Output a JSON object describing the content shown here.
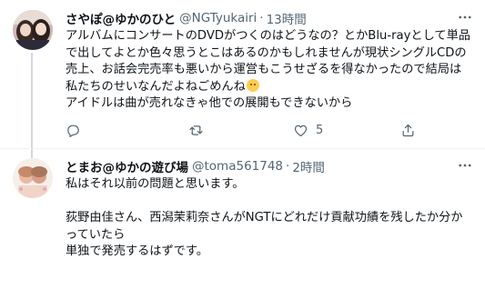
{
  "tweets": [
    {
      "display_name": "さやぽ@ゆかのひと",
      "handle": "@NGTyukairi",
      "separator": "·",
      "time": "13時間",
      "text_lines": [
        "アルバムにコンサートのDVDがつくのはどうなの？とかBlu-rayとして単品",
        "で出してよとか色々思うとこはあるのかもしれませんが現状シングルCDの",
        "売上、お話会完売率も悪いから運営もこうせざるを得なかったので結局は",
        "私たちのせいなんだよねごめんね",
        "アイドルは曲が売れなきゃ他での展開もできないから"
      ],
      "emoji_name": "crying-face-emoji",
      "reply_count": "",
      "retweet_count": "",
      "like_count": "5"
    },
    {
      "display_name": "とまお@ゆかの遊び場",
      "handle": "@toma561748",
      "separator": "·",
      "time": "2時間",
      "text_lines": [
        "私はそれ以前の問題と思います。",
        "",
        "荻野由佳さん、西潟茉莉奈さんがNGTにどれだけ貢献功績を残したか分か",
        "っていたら",
        "単独で発売するはずです。"
      ]
    }
  ],
  "icons": {
    "more": "more-horizontal-icon",
    "reply": "reply-icon",
    "retweet": "retweet-icon",
    "like": "heart-icon",
    "share": "share-icon"
  },
  "colors": {
    "text_primary": "#0f1419",
    "text_secondary": "#536471",
    "divider": "#eff3f4",
    "thread_line": "#cfd9de"
  }
}
